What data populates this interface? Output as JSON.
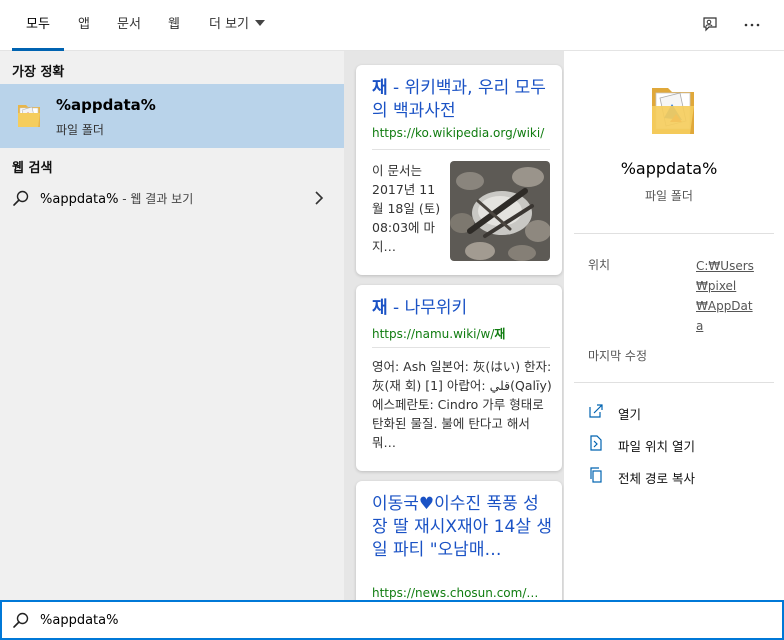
{
  "tabs": [
    {
      "label": "모두"
    },
    {
      "label": "앱"
    },
    {
      "label": "문서"
    },
    {
      "label": "웹"
    },
    {
      "label": "더 보기"
    }
  ],
  "best_match": {
    "header": "가장 정확",
    "title": "%appdata%",
    "subtitle": "파일 폴더"
  },
  "web_search": {
    "header": "웹 검색",
    "query": "%appdata%",
    "suffix": " - 웹 결과 보기"
  },
  "results": [
    {
      "title_bold": "재",
      "title_rest": " - 위키백과, 우리 모두의 백과사전",
      "url": "https://ko.wikipedia.org/wiki/",
      "snippet": "이 문서는 2017년 11월 18일 (토) 08:03에 마지…"
    },
    {
      "title_bold": "재",
      "title_rest": " - 나무위키",
      "url_prefix": "https://namu.wiki/w/",
      "url_bold": "재",
      "snippet": "영어: Ash 일본어: 灰(はい) 한자: 灰(재 회) [1] 아랍어: قلي(Qalīy) 에스페란토: Cindro 가루 형태로 탄화된 물질. 불에 탄다고 해서 뭐…"
    },
    {
      "title": "이동국♥이수진 폭풍 성장 딸 재시X재아 14살 생일 파티 \"오남매…",
      "url": "https://news.chosun.com/…"
    }
  ],
  "detail": {
    "name": "%appdata%",
    "kind": "파일 폴더",
    "location_label": "위치",
    "location_value": "C:₩Users₩pixel₩AppData",
    "modified_label": "마지막 수정",
    "actions": [
      {
        "label": "열기",
        "icon": "open-icon"
      },
      {
        "label": "파일 위치 열기",
        "icon": "file-location-icon"
      },
      {
        "label": "전체 경로 복사",
        "icon": "copy-icon"
      }
    ]
  },
  "search": {
    "value": "%appdata%"
  },
  "colors": {
    "accent": "#0063b1",
    "selection": "#b9d3ea",
    "link": "#1a52c5",
    "url": "#107c10",
    "search_border": "#0078d7"
  }
}
